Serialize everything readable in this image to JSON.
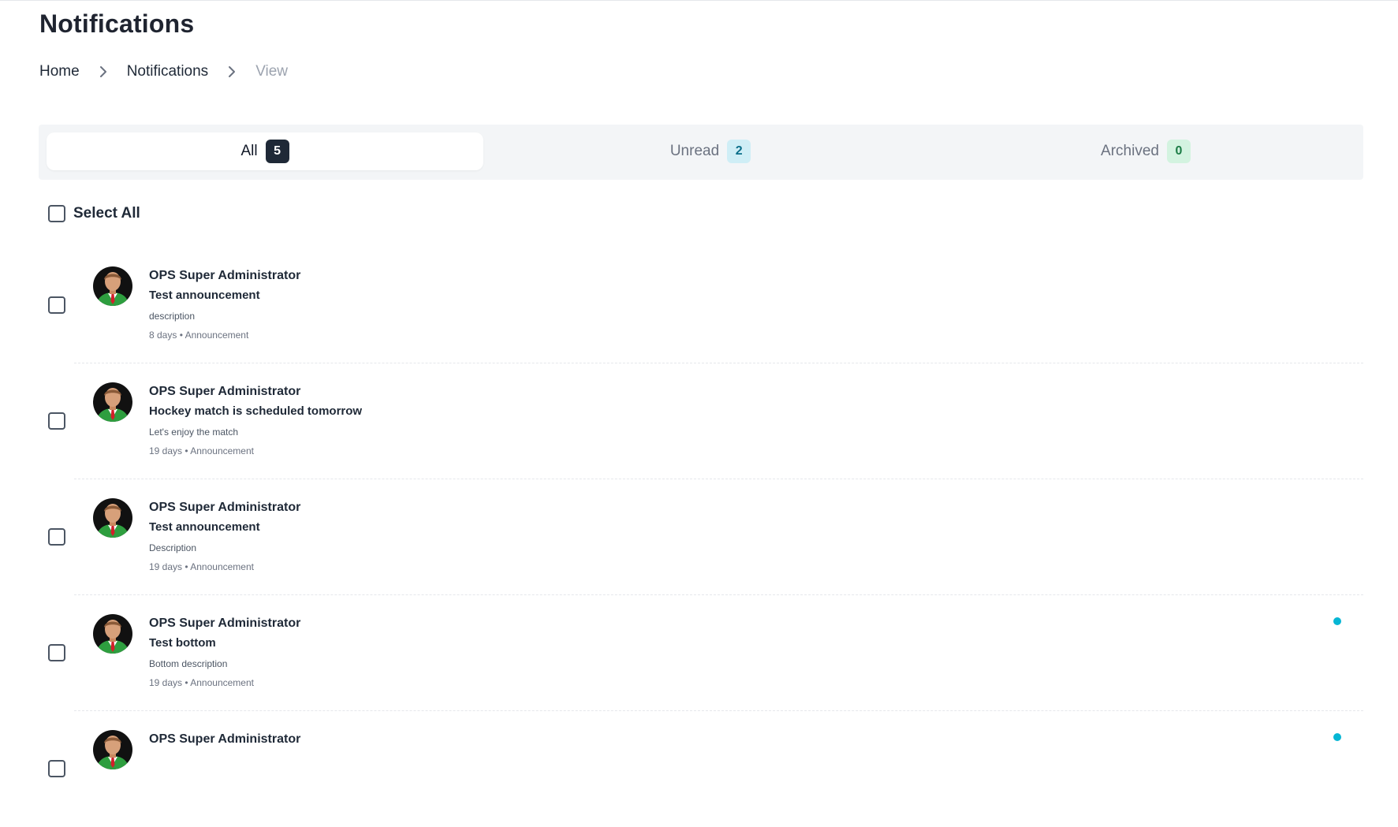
{
  "page": {
    "title": "Notifications"
  },
  "breadcrumb": [
    "Home",
    "Notifications",
    "View"
  ],
  "tabs": [
    {
      "label": "All",
      "count": "5",
      "active": true
    },
    {
      "label": "Unread",
      "count": "2"
    },
    {
      "label": "Archived",
      "count": "0"
    }
  ],
  "select_all_label": "Select All",
  "notifications": [
    {
      "sender": "OPS Super Administrator",
      "subject": "Test announcement",
      "description": "description",
      "age": "8 days",
      "type": "Announcement",
      "unread": false
    },
    {
      "sender": "OPS Super Administrator",
      "subject": "Hockey match is scheduled tomorrow",
      "description": "Let's enjoy the match",
      "age": "19 days",
      "type": "Announcement",
      "unread": false
    },
    {
      "sender": "OPS Super Administrator",
      "subject": "Test announcement",
      "description": "Description",
      "age": "19 days",
      "type": "Announcement",
      "unread": false
    },
    {
      "sender": "OPS Super Administrator",
      "subject": "Test bottom",
      "description": "Bottom description",
      "age": "19 days",
      "type": "Announcement",
      "unread": true
    },
    {
      "sender": "OPS Super Administrator",
      "subject": "",
      "description": "",
      "age": "",
      "type": "",
      "unread": true
    }
  ],
  "meta_separator": "•",
  "colors": {
    "unread_dot": "#06b6d4",
    "active_badge": "#1f2937",
    "unread_badge": "#cfeef6",
    "archived_badge": "#d3f3e0"
  }
}
